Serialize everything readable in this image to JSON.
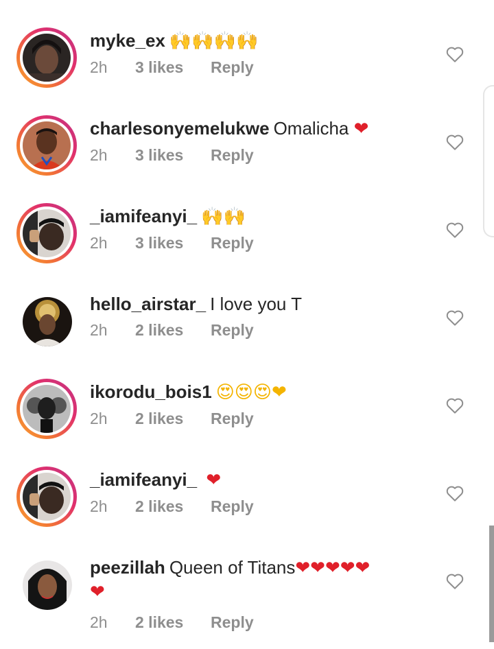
{
  "comments": [
    {
      "username": "myke_ex",
      "text": "",
      "emoji": "🙌🙌🙌🙌",
      "time": "2h",
      "likes": "3 likes",
      "reply": "Reply",
      "story_ring": true
    },
    {
      "username": "charlesonyemelukwe",
      "text": "Omalicha",
      "emoji": "❤",
      "time": "2h",
      "likes": "3 likes",
      "reply": "Reply",
      "story_ring": true
    },
    {
      "username": "_iamifeanyi_",
      "text": "",
      "emoji": "🙌🙌",
      "time": "2h",
      "likes": "3 likes",
      "reply": "Reply",
      "story_ring": true
    },
    {
      "username": "hello_airstar_",
      "text": "I love you T",
      "emoji": "",
      "time": "2h",
      "likes": "2 likes",
      "reply": "Reply",
      "story_ring": false
    },
    {
      "username": "ikorodu_bois1",
      "text": "",
      "emoji": "😍😍😍❤",
      "time": "2h",
      "likes": "2 likes",
      "reply": "Reply",
      "story_ring": true
    },
    {
      "username": "_iamifeanyi_",
      "text": "",
      "emoji": "❤",
      "time": "2h",
      "likes": "2 likes",
      "reply": "Reply",
      "story_ring": true
    },
    {
      "username": "peezillah",
      "text": "Queen of Titans",
      "emoji": "❤❤❤❤❤",
      "emoji_line2": "❤",
      "time": "2h",
      "likes": "2 likes",
      "reply": "Reply",
      "story_ring": false
    }
  ],
  "icons": {
    "like": "heart-outline-icon"
  },
  "colors": {
    "heart": "#e0202a",
    "meta": "#8e8e8e",
    "ring_start": "#f9a531",
    "ring_end": "#c13584"
  }
}
